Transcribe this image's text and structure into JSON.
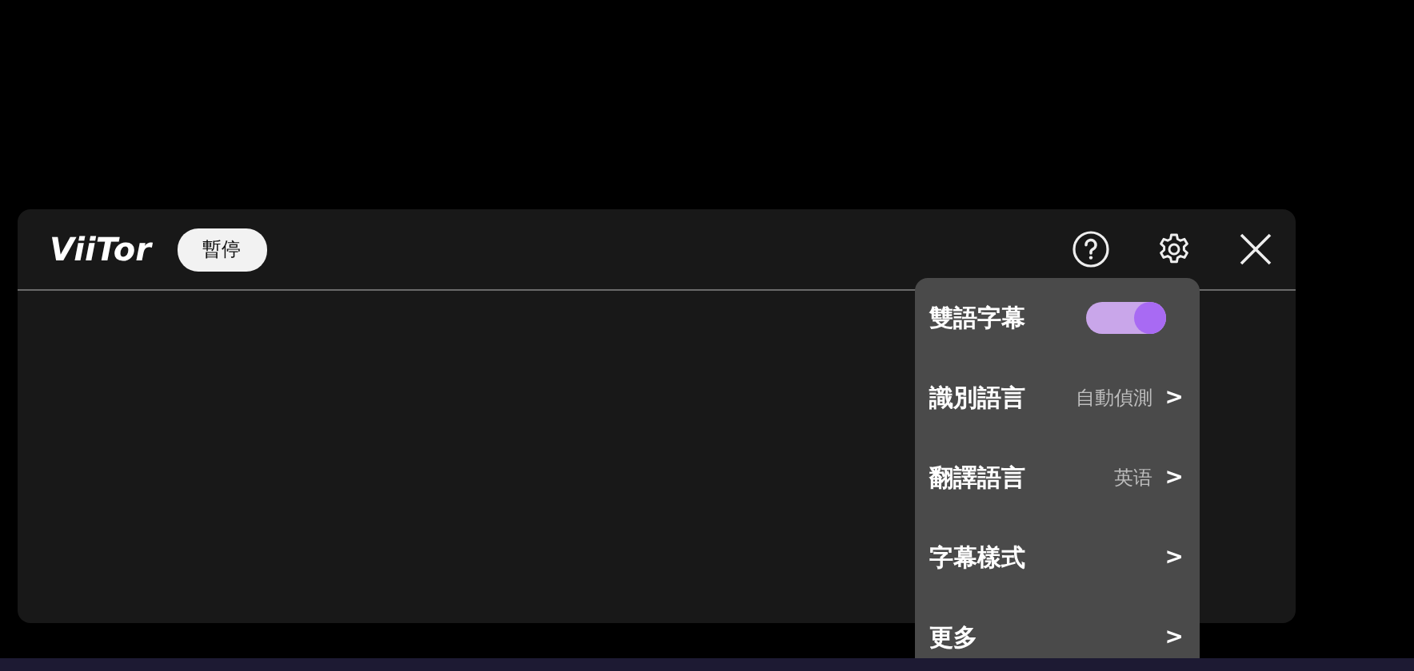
{
  "app": {
    "logo": "ViiTor",
    "pause_button": "暫停"
  },
  "menu": [
    {
      "kind": "toggle",
      "label": "雙語字幕",
      "on": true
    },
    {
      "kind": "submenu",
      "label": "識別語言",
      "value": "自動偵測",
      "arrow": ">"
    },
    {
      "kind": "submenu",
      "label": "翻譯語言",
      "value": "英语",
      "arrow": ">"
    },
    {
      "kind": "submenu",
      "label": "字幕樣式",
      "arrow": ">"
    },
    {
      "kind": "submenu",
      "label": "更多",
      "arrow": ">"
    }
  ]
}
